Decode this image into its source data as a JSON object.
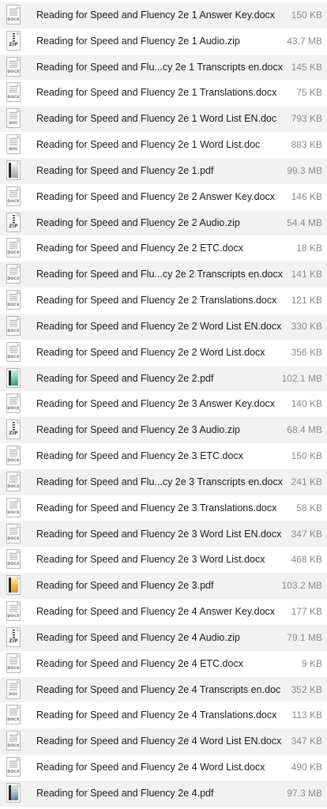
{
  "files": [
    {
      "name": "Reading for Speed and Fluency 2e 1 Answer Key.docx",
      "size": "150 KB",
      "icon": "docx-icon",
      "tag": "DOCX"
    },
    {
      "name": "Reading for Speed and Fluency 2e 1 Audio.zip",
      "size": "43.7 MB",
      "icon": "zip-icon",
      "tag": "ZIP"
    },
    {
      "name": "Reading for Speed and Flu...cy 2e 1 Transcripts en.docx",
      "size": "145 KB",
      "icon": "docx-icon",
      "tag": "DOCX"
    },
    {
      "name": "Reading for Speed and Fluency 2e 1 Translations.docx",
      "size": "75 KB",
      "icon": "docx-icon",
      "tag": "DOCX"
    },
    {
      "name": "Reading for Speed and Fluency 2e 1 Word List EN.doc",
      "size": "793 KB",
      "icon": "doc-icon",
      "tag": "DOC"
    },
    {
      "name": "Reading for Speed and Fluency 2e 1 Word List.doc",
      "size": "883 KB",
      "icon": "doc-icon",
      "tag": "DOC"
    },
    {
      "name": "Reading for Speed and Fluency 2e 1.pdf",
      "size": "99.3 MB",
      "icon": "pdf-icon",
      "tag": ""
    },
    {
      "name": "Reading for Speed and Fluency 2e 2 Answer Key.docx",
      "size": "146 KB",
      "icon": "docx-icon",
      "tag": "DOCX"
    },
    {
      "name": "Reading for Speed and Fluency 2e 2 Audio.zip",
      "size": "54.4 MB",
      "icon": "zip-icon",
      "tag": "ZIP"
    },
    {
      "name": "Reading for Speed and Fluency 2e 2 ETC.docx",
      "size": "18 KB",
      "icon": "docx-icon",
      "tag": "DOCX"
    },
    {
      "name": "Reading for Speed and Flu...cy 2e 2 Transcripts en.docx",
      "size": "141 KB",
      "icon": "docx-icon",
      "tag": "DOCX"
    },
    {
      "name": "Reading for Speed and Fluency 2e 2 Translations.docx",
      "size": "121 KB",
      "icon": "docx-icon",
      "tag": "DOCX"
    },
    {
      "name": "Reading for Speed and Fluency 2e 2 Word List EN.docx",
      "size": "330 KB",
      "icon": "docx-icon",
      "tag": "DOCX"
    },
    {
      "name": "Reading for Speed and Fluency 2e 2 Word List.docx",
      "size": "356 KB",
      "icon": "docx-icon",
      "tag": "DOCX"
    },
    {
      "name": "Reading for Speed and Fluency 2e 2.pdf",
      "size": "102.1 MB",
      "icon": "pdf-icon",
      "tag": ""
    },
    {
      "name": "Reading for Speed and Fluency 2e 3 Answer Key.docx",
      "size": "140 KB",
      "icon": "docx-icon",
      "tag": "DOCX"
    },
    {
      "name": "Reading for Speed and Fluency 2e 3 Audio.zip",
      "size": "68.4 MB",
      "icon": "zip-icon",
      "tag": "ZIP"
    },
    {
      "name": "Reading for Speed and Fluency 2e 3 ETC.docx",
      "size": "150 KB",
      "icon": "docx-icon",
      "tag": "DOCX"
    },
    {
      "name": "Reading for Speed and Flu...cy 2e 3 Transcripts en.docx",
      "size": "241 KB",
      "icon": "docx-icon",
      "tag": "DOCX"
    },
    {
      "name": "Reading for Speed and Fluency 2e 3 Translations.docx",
      "size": "58 KB",
      "icon": "docx-icon",
      "tag": "DOCX"
    },
    {
      "name": "Reading for Speed and Fluency 2e 3 Word List EN.docx",
      "size": "347 KB",
      "icon": "docx-icon",
      "tag": "DOCX"
    },
    {
      "name": "Reading for Speed and Fluency 2e 3 Word List.docx",
      "size": "468 KB",
      "icon": "docx-icon",
      "tag": "DOCX"
    },
    {
      "name": "Reading for Speed and Fluency 2e 3.pdf",
      "size": "103.2 MB",
      "icon": "pdf-icon",
      "tag": ""
    },
    {
      "name": "Reading for Speed and Fluency 2e 4 Answer Key.docx",
      "size": "177 KB",
      "icon": "docx-icon",
      "tag": "DOCX"
    },
    {
      "name": "Reading for Speed and Fluency 2e 4 Audio.zip",
      "size": "79.1 MB",
      "icon": "zip-icon",
      "tag": "ZIP"
    },
    {
      "name": "Reading for Speed and Fluency 2e 4 ETC.docx",
      "size": "9 KB",
      "icon": "docx-icon",
      "tag": "DOCX"
    },
    {
      "name": "Reading for Speed and Fluency 2e 4 Transcripts en.doc",
      "size": "352 KB",
      "icon": "doc-icon",
      "tag": "DOC"
    },
    {
      "name": "Reading for Speed and Fluency 2e 4 Translations.docx",
      "size": "113 KB",
      "icon": "docx-icon",
      "tag": "DOCX"
    },
    {
      "name": "Reading for Speed and Fluency 2e 4 Word List EN.docx",
      "size": "347 KB",
      "icon": "docx-icon",
      "tag": "DOCX"
    },
    {
      "name": "Reading for Speed and Fluency 2e 4 Word List.docx",
      "size": "490 KB",
      "icon": "docx-icon",
      "tag": "DOCX"
    },
    {
      "name": "Reading for Speed and Fluency 2e 4.pdf",
      "size": "97.3 MB",
      "icon": "pdf-icon",
      "tag": ""
    }
  ],
  "colors": {
    "row_alt": "#f2f2f2",
    "text": "#1a1a1a",
    "size_text": "#8a8a8a"
  }
}
